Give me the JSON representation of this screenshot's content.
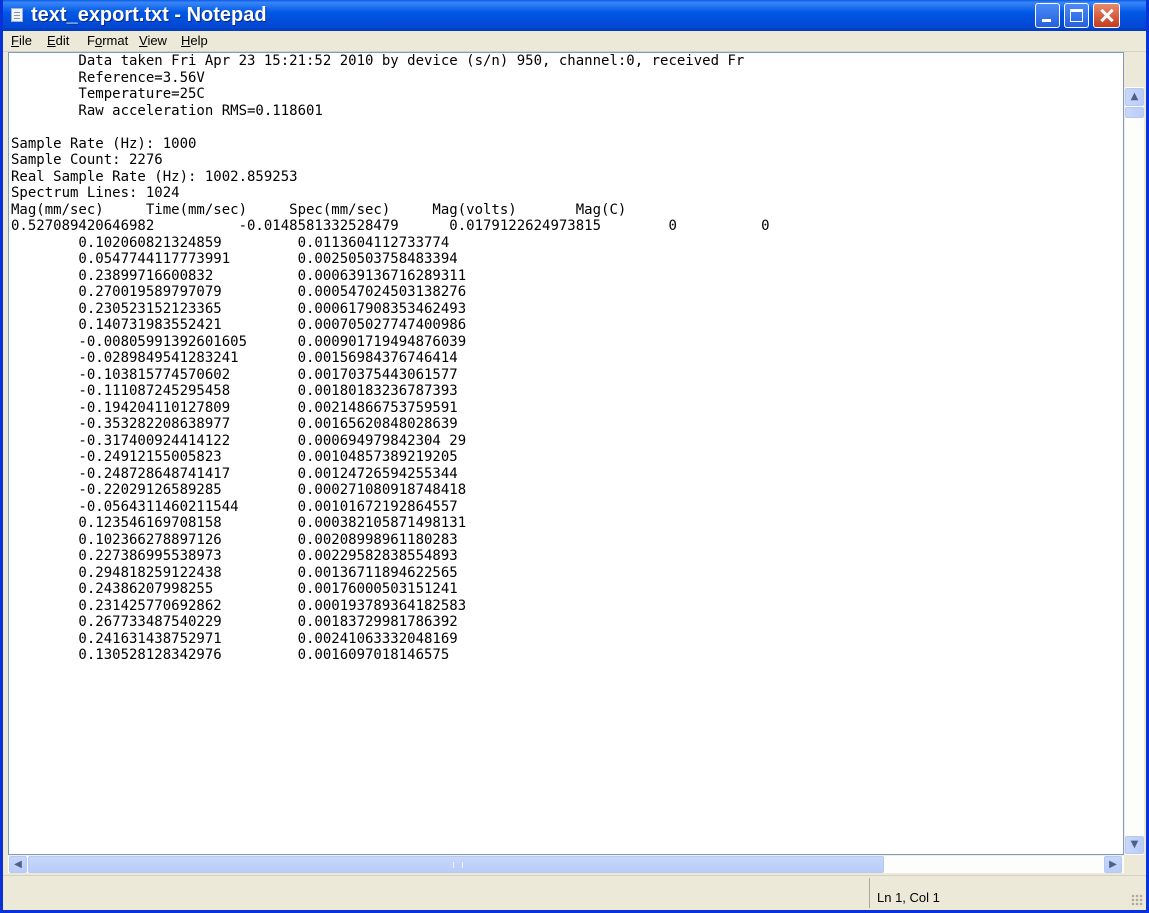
{
  "window": {
    "title": "text_export.txt - Notepad"
  },
  "menu": {
    "file": {
      "mnemonic": "F",
      "rest": "ile"
    },
    "edit": {
      "mnemonic": "E",
      "rest": "dit"
    },
    "format": {
      "pre": "F",
      "mnemonic": "o",
      "rest": "rmat"
    },
    "view": {
      "mnemonic": "V",
      "rest": "iew"
    },
    "help": {
      "mnemonic": "H",
      "rest": "elp"
    }
  },
  "document": {
    "text": "        Data taken Fri Apr 23 15:21:52 2010 by device (s/n) 950, channel:0, received Fr\n        Reference=3.56V\n        Temperature=25C\n        Raw acceleration RMS=0.118601\n\nSample Rate (Hz): 1000\nSample Count: 2276\nReal Sample Rate (Hz): 1002.859253\nSpectrum Lines: 1024\nMag(mm/sec)     Time(mm/sec)     Spec(mm/sec)     Mag(volts)       Mag(C)\n0.527089420646982          -0.0148581332528479      0.0179122624973815        0          0\n        0.102060821324859         0.0113604112733774\n        0.0547744117773991        0.00250503758483394\n        0.23899716600832          0.000639136716289311\n        0.270019589797079         0.000547024503138276\n        0.230523152123365         0.000617908353462493\n        0.140731983552421         0.000705027747400986\n        -0.00805991392601605      0.000901719494876039\n        -0.0289849541283241       0.00156984376746414\n        -0.103815774570602        0.00170375443061577\n        -0.111087245295458        0.00180183236787393\n        -0.194204110127809        0.00214866753759591\n        -0.353282208638977        0.00165620848028639\n        -0.317400924414122        0.000694979842304 29\n        -0.24912155005823         0.00104857389219205\n        -0.248728648741417        0.00124726594255344\n        -0.22029126589285         0.000271080918748418\n        -0.0564311460211544       0.00101672192864557\n        0.123546169708158         0.000382105871498131\n        0.102366278897126         0.00208998961180283\n        0.227386995538973         0.00229582838554893\n        0.294818259122438         0.00136711894622565\n        0.24386207998255          0.00176000503151241\n        0.231425770692862         0.000193789364182583\n        0.267733487540229         0.00183729981786392\n        0.241631438752971         0.00241063332048169\n        0.130528128342976         0.0016097018146575"
  },
  "status": {
    "position": "Ln 1, Col 1"
  }
}
